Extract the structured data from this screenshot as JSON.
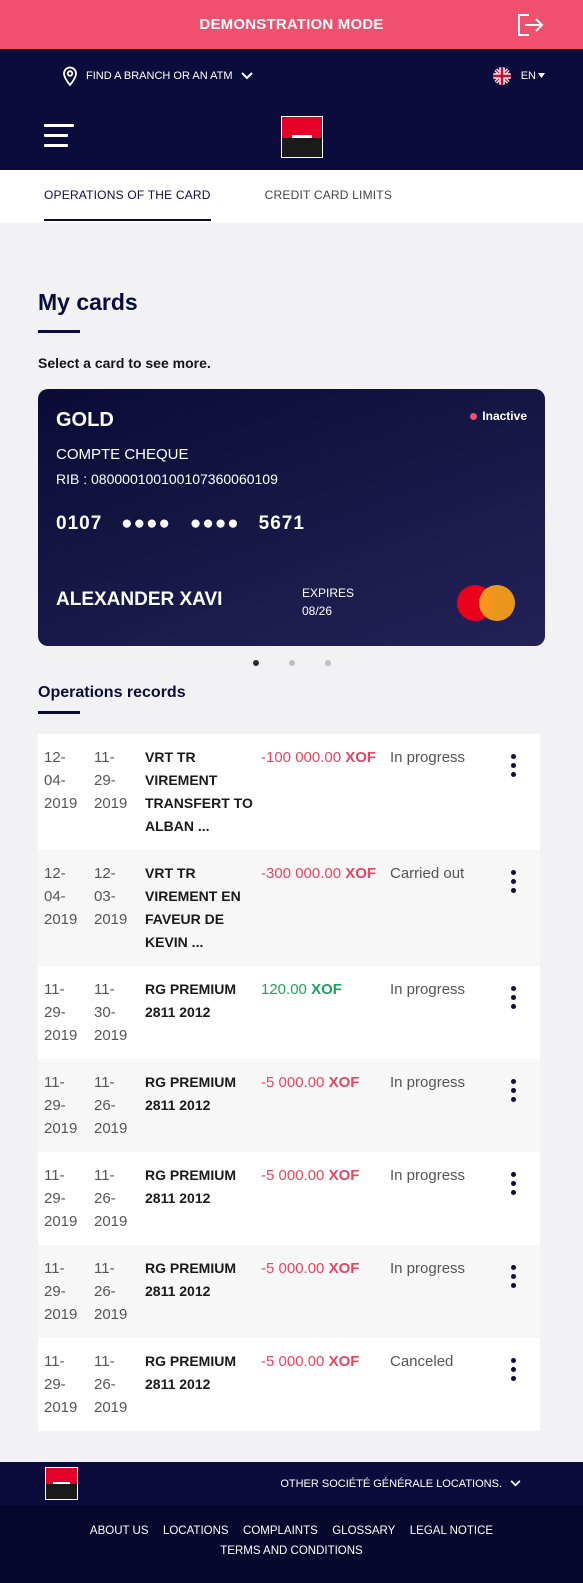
{
  "demo": {
    "title": "DEMONSTRATION MODE"
  },
  "topnav": {
    "branch_label": "FIND A BRANCH OR AN ATM",
    "lang_label": "EN"
  },
  "tabs": [
    {
      "label": "OPERATIONS OF THE CARD"
    },
    {
      "label": "CREDIT CARD LIMITS"
    }
  ],
  "page": {
    "title": "My cards",
    "subtitle": "Select a card to see more.",
    "records_title": "Operations records"
  },
  "card": {
    "type": "GOLD",
    "status": "Inactive",
    "account": "COMPTE CHEQUE",
    "rib": "RIB : 080000100100107360060109",
    "number_start": "0107",
    "number_mask1": "●●●●",
    "number_mask2": "●●●●",
    "number_end": "5671",
    "holder": "ALEXANDER XAVI",
    "expires_label": "EXPIRES",
    "expires_value": "08/26"
  },
  "operations": [
    {
      "date1": "12-\n04-\n2019",
      "date2": "11-\n29-\n2019",
      "desc": "VRT TR VIREMENT TRANSFERT TO ALBAN ...",
      "amount": "-100 000.00",
      "currency": "XOF",
      "sign": "neg",
      "status": "In progress"
    },
    {
      "date1": "12-\n04-\n2019",
      "date2": "12-\n03-\n2019",
      "desc": "VRT TR VIREMENT EN FAVEUR DE KEVIN ...",
      "amount": "-300 000.00",
      "currency": "XOF",
      "sign": "neg",
      "status": "Carried out"
    },
    {
      "date1": "11-\n29-\n2019",
      "date2": "11-\n30-\n2019",
      "desc": "RG PREMIUM 2811 2012",
      "amount": "120.00",
      "currency": "XOF",
      "sign": "pos",
      "status": "In progress"
    },
    {
      "date1": "11-\n29-\n2019",
      "date2": "11-\n26-\n2019",
      "desc": "RG PREMIUM 2811 2012",
      "amount": "-5 000.00",
      "currency": "XOF",
      "sign": "neg",
      "status": "In progress"
    },
    {
      "date1": "11-\n29-\n2019",
      "date2": "11-\n26-\n2019",
      "desc": "RG PREMIUM 2811 2012",
      "amount": "-5 000.00",
      "currency": "XOF",
      "sign": "neg",
      "status": "In progress"
    },
    {
      "date1": "11-\n29-\n2019",
      "date2": "11-\n26-\n2019",
      "desc": "RG PREMIUM 2811 2012",
      "amount": "-5 000.00",
      "currency": "XOF",
      "sign": "neg",
      "status": "In progress"
    },
    {
      "date1": "11-\n29-\n2019",
      "date2": "11-\n26-\n2019",
      "desc": "RG PREMIUM 2811 2012",
      "amount": "-5 000.00",
      "currency": "XOF",
      "sign": "neg",
      "status": "Canceled"
    }
  ],
  "footer": {
    "other_locations": "OTHER SOCIÉTÉ GÉNÉRALE LOCATIONS.",
    "links": [
      "ABOUT US",
      "LOCATIONS",
      "COMPLAINTS",
      "GLOSSARY",
      "LEGAL NOTICE",
      "TERMS AND CONDITIONS"
    ]
  },
  "colors": {
    "navy": "#0c0c3c",
    "demo_red": "#f0506e",
    "negative": "#e8455f",
    "positive": "#1fa35b"
  }
}
